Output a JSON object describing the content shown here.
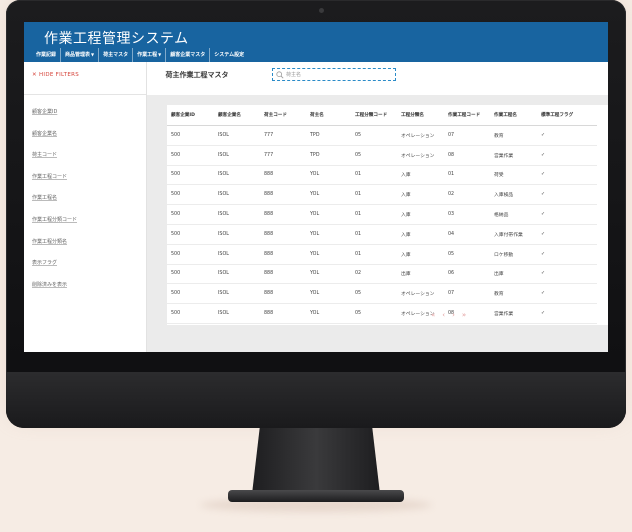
{
  "app": {
    "title": "作業工程管理システム",
    "nav": [
      {
        "label": "作業記録",
        "caret": false
      },
      {
        "label": "商品管理表",
        "caret": true
      },
      {
        "label": "荷主マスタ",
        "caret": false
      },
      {
        "label": "作業工程",
        "caret": true
      },
      {
        "label": "顧客企業マスタ",
        "caret": false
      },
      {
        "label": "システム設定",
        "caret": false
      }
    ]
  },
  "filters": {
    "hide_label": "✕ HIDE FILTERS",
    "items": [
      "顧客企業ID",
      "顧客企業名",
      "荷主コード",
      "作業工程コード",
      "作業工程名",
      "作業工程分類コード",
      "作業工程分類名",
      "表示フラグ",
      "削除済みを表示"
    ]
  },
  "page": {
    "title": "荷主作業工程マスタ",
    "search_placeholder": "荷主名"
  },
  "table": {
    "columns": [
      "顧客企業ID",
      "顧客企業名",
      "荷主コード",
      "荷主名",
      "工程分類コード",
      "工程分類名",
      "作業工程コード",
      "作業工程名",
      "標準工程フラグ"
    ],
    "rows": [
      [
        "500",
        "ISOL",
        "777",
        "TPD",
        "05",
        "オペレーション",
        "07",
        "教育",
        "✓"
      ],
      [
        "500",
        "ISOL",
        "777",
        "TPD",
        "05",
        "オペレーション",
        "08",
        "営業作業",
        "✓"
      ],
      [
        "500",
        "ISOL",
        "888",
        "YOL",
        "01",
        "入庫",
        "01",
        "荷受",
        "✓"
      ],
      [
        "500",
        "ISOL",
        "888",
        "YOL",
        "01",
        "入庫",
        "02",
        "入庫検品",
        "✓"
      ],
      [
        "500",
        "ISOL",
        "888",
        "YOL",
        "01",
        "入庫",
        "03",
        "格納品",
        "✓"
      ],
      [
        "500",
        "ISOL",
        "888",
        "YOL",
        "01",
        "入庫",
        "04",
        "入庫付帯作業",
        "✓"
      ],
      [
        "500",
        "ISOL",
        "888",
        "YOL",
        "01",
        "入庫",
        "05",
        "ロケ移動",
        "✓"
      ],
      [
        "500",
        "ISOL",
        "888",
        "YOL",
        "02",
        "出庫",
        "06",
        "出庫",
        "✓"
      ],
      [
        "500",
        "ISOL",
        "888",
        "YOL",
        "05",
        "オペレーション",
        "07",
        "教育",
        "✓"
      ],
      [
        "500",
        "ISOL",
        "888",
        "YOL",
        "05",
        "オペレーション",
        "08",
        "営業作業",
        "✓"
      ]
    ]
  },
  "pager": {
    "first": "«",
    "prev": "‹",
    "next": "›",
    "last": "»"
  },
  "colors": {
    "header": "#1864a0",
    "hide_filters": "#d5433a",
    "pager": "#e29a9a",
    "search_border": "#2a8bc8"
  }
}
